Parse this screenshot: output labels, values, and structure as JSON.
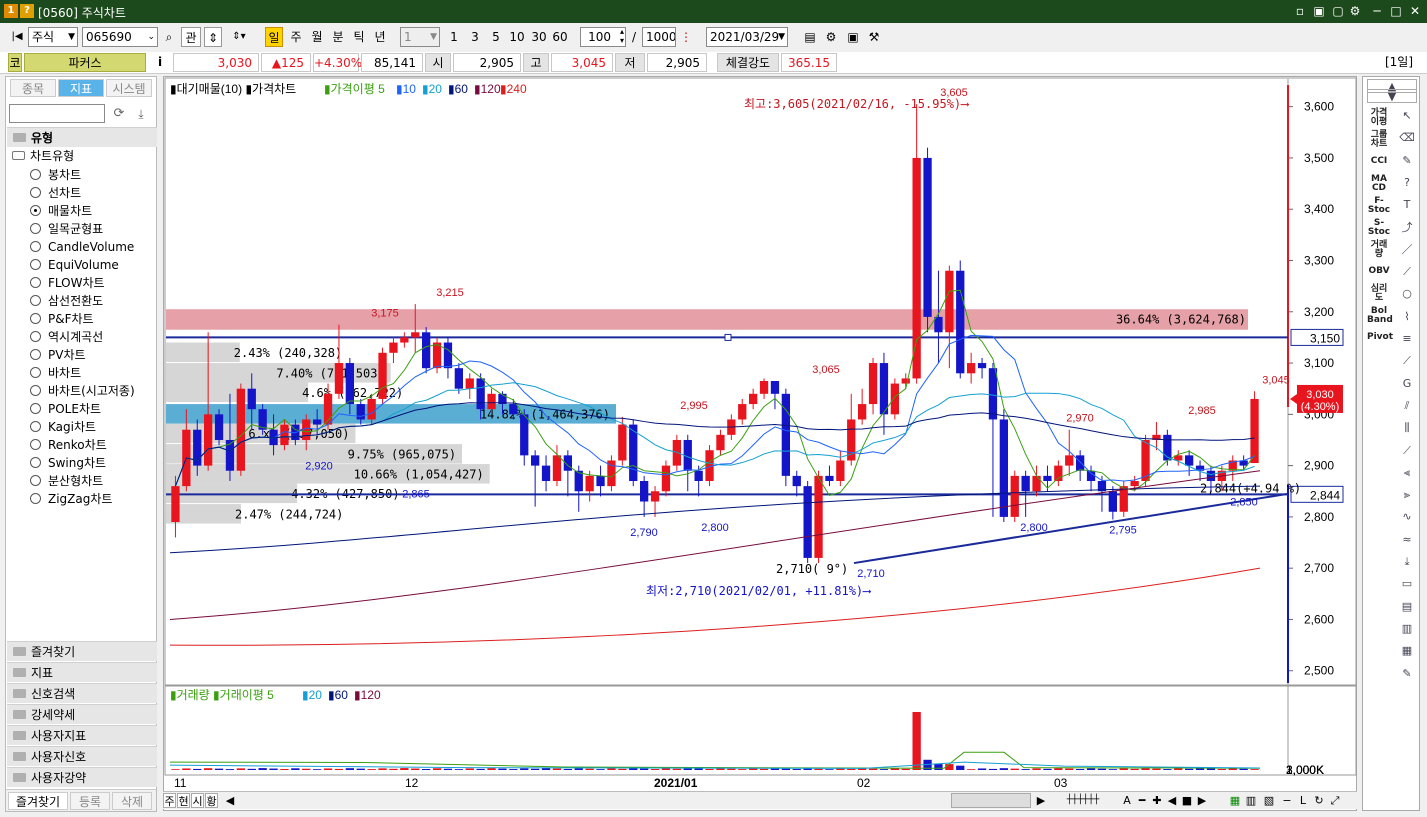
{
  "window": {
    "badge1": "1",
    "badge2": "?",
    "title": "[0560] 주식차트",
    "controls": [
      "▫",
      "▣",
      "▢",
      "⚙",
      "─",
      "□",
      "✕"
    ]
  },
  "toolbar": {
    "market": "주식",
    "code": "065690",
    "btn_related": "관",
    "periods": [
      "일",
      "주",
      "월",
      "분",
      "틱",
      "년"
    ],
    "period_selected": "일",
    "interval": "1",
    "quick": [
      "1",
      "3",
      "5",
      "10",
      "30",
      "60"
    ],
    "count": "100",
    "slash": "/",
    "total": "1000",
    "date": "2021/03/29"
  },
  "quote": {
    "market_badge": "코",
    "name": "파커스",
    "info": "i",
    "price": "3,030",
    "change": "▲125",
    "change_pct": "+4.30%",
    "volume": "85,141",
    "open_label": "시",
    "open": "2,905",
    "high_label": "고",
    "high": "3,045",
    "low_label": "저",
    "low": "2,905",
    "strength_label": "체결강도",
    "strength": "365.15",
    "period_badge": "[1일]"
  },
  "left": {
    "tabs": [
      "종목",
      "지표",
      "시스템"
    ],
    "active_tab": "지표",
    "group_header": "유형",
    "tree_root": "차트유형",
    "chart_types": [
      "봉차트",
      "선차트",
      "매물차트",
      "일목균형표",
      "CandleVolume",
      "EquiVolume",
      "FLOW차트",
      "삼선전환도",
      "P&F차트",
      "역시계곡선",
      "PV차트",
      "바차트",
      "바차트(시고저종)",
      "POLE차트",
      "Kagi차트",
      "Renko차트",
      "Swing차트",
      "분산형차트",
      "ZigZag차트"
    ],
    "selected": "매물차트",
    "groups": [
      "즐겨찾기",
      "지표",
      "신호검색",
      "강세약세",
      "사용자지표",
      "사용자신호",
      "사용자강약"
    ],
    "bottom_tabs": [
      "즐겨찾기",
      "등록",
      "삭제"
    ]
  },
  "chart": {
    "legend": {
      "vp": "대기매물(10)",
      "price": "가격차트",
      "ma": "가격이평",
      "ma_periods": [
        "5",
        "10",
        "20",
        "60",
        "120",
        "240"
      ]
    },
    "vol_legend": {
      "vol": "거래량",
      "ma": "거래이평",
      "ma_periods": [
        "5",
        "20",
        "60",
        "120"
      ]
    },
    "price_axis": [
      "3,600",
      "3,500",
      "3,400",
      "3,300",
      "3,200",
      "3,100",
      "3,000",
      "2,900",
      "2,800",
      "2,700",
      "2,600",
      "2,500"
    ],
    "vol_axis": [
      "3,000K",
      "2,000K",
      "1,000K",
      "0K"
    ],
    "x_labels": [
      "11",
      "12",
      "2021/01",
      "02",
      "03"
    ],
    "annotations": {
      "max": "최고:3,605(2021/02/16, -15.95%)",
      "min": "최저:2,710(2021/02/01, +11.81%)",
      "trend": "2,710( 9°)",
      "hline1": "3,150",
      "hline2": "2,844",
      "hline2_note": "2,844(+4.94 %)",
      "current": "3,030",
      "current_pct": "(4.30%)"
    },
    "peak_labels": [
      "3,605",
      "3,215",
      "3,175",
      "3,065",
      "2,995",
      "2,970",
      "2,985",
      "3,045",
      "2,920",
      "2,865",
      "2,790",
      "2,800",
      "2,710",
      "2,800",
      "2,795",
      "2,850"
    ],
    "profile": [
      {
        "label": "2.43% (240,328)",
        "pct": 2.43,
        "hl": false
      },
      {
        "label": "7.40% (731,503)",
        "pct": 7.4,
        "hl": false
      },
      {
        "label": "4.6% (462,722)",
        "pct": 4.68,
        "hl": false
      },
      {
        "label": "14.82% (1,464,376)",
        "pct": 14.82,
        "hl": true
      },
      {
        "label": "6.x% (617,050)",
        "pct": 6.24,
        "hl": false
      },
      {
        "label": "9.75% (965,075)",
        "pct": 9.75,
        "hl": false
      },
      {
        "label": "10.66% (1,054,427)",
        "pct": 10.66,
        "hl": false
      },
      {
        "label": "4.32% (427,850)",
        "pct": 4.32,
        "hl": false
      },
      {
        "label": "2.47% (244,724)",
        "pct": 2.47,
        "hl": false
      }
    ],
    "top_band": "36.64% (3,624,768)"
  },
  "bottom_nav": [
    "주",
    "현",
    "시",
    "황"
  ],
  "colors": {
    "up": "#e8141e",
    "down": "#1414c8",
    "ma5": "#3aa010",
    "ma10": "#1e64ff",
    "ma20": "#14a0d2",
    "ma60": "#00147a",
    "ma120": "#780a3c",
    "ma240": "#dc1e1e"
  }
}
